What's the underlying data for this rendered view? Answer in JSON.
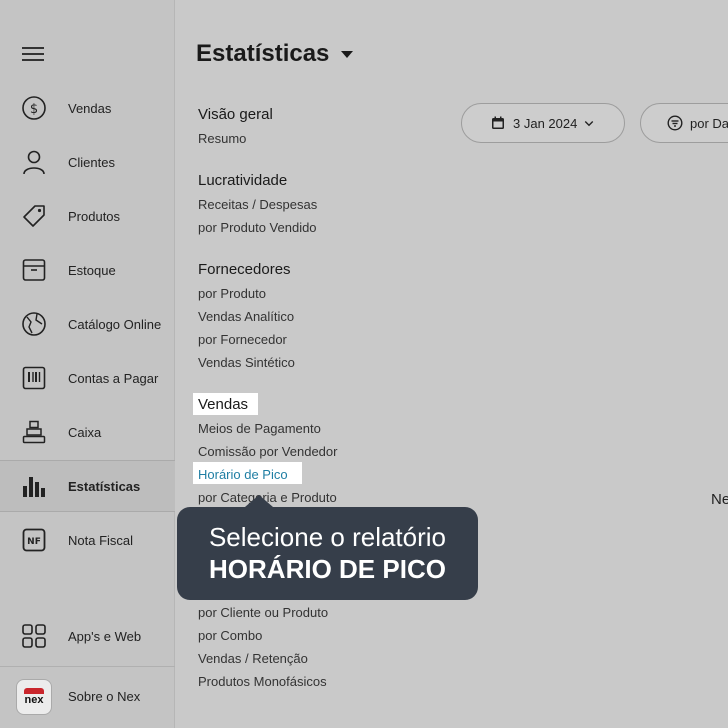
{
  "sidebar": {
    "items": [
      {
        "label": "Vendas",
        "icon": "dollar-circle-icon"
      },
      {
        "label": "Clientes",
        "icon": "user-icon"
      },
      {
        "label": "Produtos",
        "icon": "tag-icon"
      },
      {
        "label": "Estoque",
        "icon": "box-icon"
      },
      {
        "label": "Catálogo Online",
        "icon": "globe-icon"
      },
      {
        "label": "Contas a Pagar",
        "icon": "barcode-icon"
      },
      {
        "label": "Caixa",
        "icon": "cash-register-icon"
      },
      {
        "label": "Estatísticas",
        "icon": "bar-chart-icon"
      },
      {
        "label": "Nota Fiscal",
        "icon": "nf-icon"
      }
    ],
    "apps_label": "App's e Web",
    "about_label": "Sobre o Nex",
    "logo_text": "nex"
  },
  "header": {
    "title": "Estatísticas",
    "date_filter": "3 Jan 2024",
    "group_filter": "por Da"
  },
  "sections": [
    {
      "title": "Visão geral",
      "items": [
        "Resumo"
      ]
    },
    {
      "title": "Lucratividade",
      "items": [
        "Receitas / Despesas",
        "por Produto Vendido"
      ]
    },
    {
      "title": "Fornecedores",
      "items": [
        "por Produto",
        "Vendas Analítico",
        "por Fornecedor",
        "Vendas Sintético"
      ]
    },
    {
      "title": "Vendas",
      "items": [
        "Meios de Pagamento",
        "Comissão por Vendedor",
        "Horário de Pico",
        "por Categoria e Produto",
        "por Cliente ou Produto",
        "por Combo",
        "Vendas / Retenção",
        "Produtos Monofásicos"
      ]
    }
  ],
  "right_partial_text": "Ne",
  "tooltip": {
    "line1": "Selecione o relatório",
    "line2": "HORÁRIO DE PICO"
  },
  "colors": {
    "highlight_link": "#1f7ea3",
    "tooltip_bg": "#363e4a"
  }
}
